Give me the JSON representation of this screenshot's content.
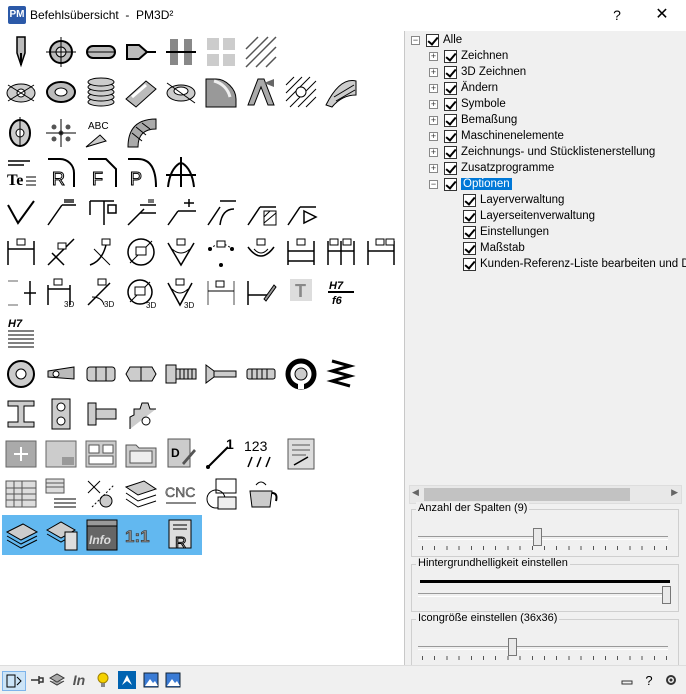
{
  "window": {
    "title": "Befehlsübersicht  -  PM3D²",
    "app_icon_text": "PM",
    "help_label": "?",
    "close_label": "✕"
  },
  "tree": [
    {
      "label": "Alle",
      "level": 0,
      "expander": "-",
      "checked": true
    },
    {
      "label": "Zeichnen",
      "level": 1,
      "expander": "+",
      "checked": true
    },
    {
      "label": "3D Zeichnen",
      "level": 1,
      "expander": "+",
      "checked": true
    },
    {
      "label": "Ändern",
      "level": 1,
      "expander": "+",
      "checked": true
    },
    {
      "label": "Symbole",
      "level": 1,
      "expander": "+",
      "checked": true
    },
    {
      "label": "Bemaßung",
      "level": 1,
      "expander": "+",
      "checked": true
    },
    {
      "label": "Maschinenelemente",
      "level": 1,
      "expander": "+",
      "checked": true
    },
    {
      "label": "Zeichnungs- und Stücklistenerstellung",
      "level": 1,
      "expander": "+",
      "checked": true
    },
    {
      "label": "Zusatzprogramme",
      "level": 1,
      "expander": "+",
      "checked": true
    },
    {
      "label": "Optionen",
      "level": 1,
      "expander": "-",
      "checked": true,
      "selected": true
    },
    {
      "label": "Layerverwaltung",
      "level": 2,
      "expander": "",
      "checked": true
    },
    {
      "label": "Layerseitenverwaltung",
      "level": 2,
      "expander": "",
      "checked": true
    },
    {
      "label": "Einstellungen",
      "level": 2,
      "expander": "",
      "checked": true
    },
    {
      "label": "Maßstab",
      "level": 2,
      "expander": "",
      "checked": true
    },
    {
      "label": "Kunden-Referenz-Liste bearbeiten und Date",
      "level": 2,
      "expander": "",
      "checked": true
    }
  ],
  "settings": {
    "columns_label": "Anzahl der Spalten (9)",
    "columns_value": 9,
    "columns_fraction": 0.47,
    "brightness_label": "Hintergrundhelligkeit einstellen",
    "brightness_fraction": 1.0,
    "iconsize_label": "Icongröße einstellen  (36x36)",
    "iconsize_fraction": 0.37
  },
  "icon_texts": {
    "abc": "ABC",
    "h7": "H7",
    "f6": "f6",
    "cnc": "CNC",
    "info": "Info",
    "scale": "1:1",
    "digits": "123",
    "te": "Te"
  },
  "icons": [
    "pen-icon",
    "circle-crosshair-icon",
    "slot-icon",
    "chamfer-icon",
    "section-icon",
    "grid-pattern-icon",
    "hatch-icon",
    "circle-pattern-icon",
    "ring-icon",
    "thread-icon",
    "ramp-icon",
    "bore-icon",
    "fillet-3d-icon",
    "text-3d-icon",
    "spiral-icon",
    "circle-edit-icon",
    "point-array-icon",
    "abc-pattern-icon",
    "spring-surface-icon",
    "text-icon",
    "radius-r-icon",
    "radius-f-icon",
    "radius-p-icon",
    "thread-lines-icon",
    "weld-icon",
    "weld-flag-icon",
    "weld-frame-icon",
    "weld-double-icon",
    "weld-plus-icon",
    "weld-curve-icon",
    "weld-hatch-icon",
    "weld-cone-icon",
    "dim-linear-icon",
    "dim-angle-icon",
    "dim-arc-icon",
    "dim-diameter-icon",
    "dim-cone-icon",
    "dim-arc-points-icon",
    "dim-radius-icon",
    "dim-chain-icon",
    "dim-baseline-icon",
    "dim-ortho-icon",
    "dim-3d-angle-icon",
    "dim-3d-arc-icon",
    "dim-3d-diameter-icon",
    "dim-3d-cone-icon",
    "dim-vertical-icon",
    "dim-slope-icon",
    "dim-text-icon",
    "tolerance-fit-icon",
    "tolerance-table-icon",
    "washer-icon",
    "pin-icon",
    "hex-nut-icon",
    "nut-icon",
    "hex-screw-icon",
    "countersink-screw-icon",
    "grub-screw-icon",
    "circlip-icon",
    "spring-icon",
    "i-beam-icon",
    "bearing-icon",
    "bolt-icon",
    "gear-icon",
    "new-sheet-icon",
    "sheet-fold-icon",
    "layout-icon",
    "folder-icon",
    "edit-doc-icon",
    "numbering-icon",
    "digits-icon",
    "list-doc-icon",
    "table-icon",
    "parts-list-icon",
    "explode-icon",
    "layers-stack-icon",
    "cnc-icon",
    "frame-icon",
    "kettle-icon",
    "layer-manager-icon",
    "layer-pages-icon",
    "info-icon",
    "scale-icon",
    "reference-list-icon"
  ],
  "bottom_icons": [
    "dock-icon",
    "pin-icon",
    "layers-icon",
    "info-icon",
    "bulb-icon",
    "cursor-icon",
    "picture-icon",
    "picture-edit-icon"
  ],
  "bottom_right": [
    "minimize-icon",
    "help-icon",
    "settings-icon"
  ]
}
